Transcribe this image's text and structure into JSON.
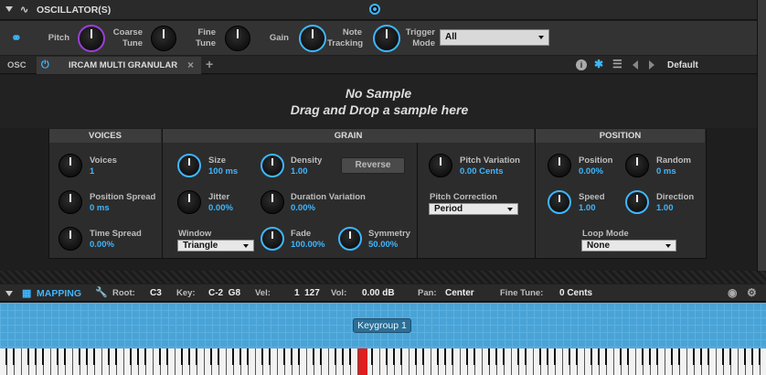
{
  "header": {
    "title": "OSCILLATOR(S)"
  },
  "controls": {
    "pitch": "Pitch",
    "coarse_tune": "Coarse\nTune",
    "fine_tune": "Fine\nTune",
    "gain": "Gain",
    "note_tracking": "Note\nTracking",
    "trigger_mode": "Trigger\nMode",
    "trigger_mode_value": "All"
  },
  "tabs": {
    "osc": "OSC",
    "active": "IRCAM MULTI GRANULAR",
    "preset": "Default"
  },
  "drop": {
    "line1": "No Sample",
    "line2": "Drag and Drop a sample here"
  },
  "voices": {
    "title": "VOICES",
    "voices": "Voices",
    "voices_val": "1",
    "pos_spread": "Position Spread",
    "pos_spread_val": "0 ms",
    "time_spread": "Time Spread",
    "time_spread_val": "0.00%"
  },
  "grain": {
    "title": "GRAIN",
    "size": "Size",
    "size_val": "100 ms",
    "density": "Density",
    "density_val": "1.00",
    "reverse": "Reverse",
    "jitter": "Jitter",
    "jitter_val": "0.00%",
    "dur_var": "Duration Variation",
    "dur_var_val": "0.00%",
    "window": "Window",
    "window_val": "Triangle",
    "fade": "Fade",
    "fade_val": "100.00%",
    "symmetry": "Symmetry",
    "symmetry_val": "50.00%",
    "pitch_var": "Pitch Variation",
    "pitch_var_val": "0.00 Cents",
    "pitch_corr": "Pitch Correction",
    "pitch_corr_val": "Period"
  },
  "position": {
    "title": "POSITION",
    "position": "Position",
    "position_val": "0.00%",
    "random": "Random",
    "random_val": "0 ms",
    "speed": "Speed",
    "speed_val": "1.00",
    "direction": "Direction",
    "direction_val": "1.00",
    "loop_mode": "Loop Mode",
    "loop_mode_val": "None"
  },
  "mapping": {
    "title": "MAPPING",
    "root_l": "Root:",
    "root": "C3",
    "key_l": "Key:",
    "key": "C-2  G8",
    "vel_l": "Vel:",
    "vel": "1  127",
    "vol_l": "Vol:",
    "vol": "0.00 dB",
    "pan_l": "Pan:",
    "pan": "Center",
    "ft_l": "Fine Tune:",
    "ft": "0 Cents",
    "keygroup": "Keygroup 1"
  },
  "colors": {
    "accent": "#3fb6ff",
    "map_bg": "#4aa3d6"
  }
}
